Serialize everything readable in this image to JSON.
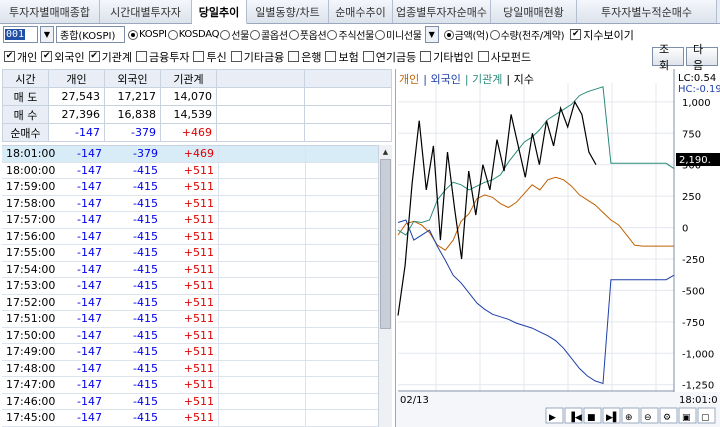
{
  "tabs": [
    "투자자별매매종합",
    "시간대별투자자",
    "당일추이",
    "일별동향/차트",
    "순매수추이",
    "업종별투자자순매수",
    "당일매매현황",
    "투자자별누적순매수"
  ],
  "active_tab": 2,
  "toolbar1": {
    "code": "001",
    "market_name": "종합(KOSPI)",
    "market_radios": [
      "KOSPI",
      "KOSDAQ",
      "선물",
      "콜옵션",
      "풋옵션",
      "주식선물",
      "미니선물"
    ],
    "unit_radios": [
      "금액(억)",
      "수량(천주/계약)"
    ],
    "index_view_label": "지수보이기"
  },
  "toolbar2": {
    "checkboxes": [
      {
        "label": "개인",
        "checked": true
      },
      {
        "label": "외국인",
        "checked": true
      },
      {
        "label": "기관계",
        "checked": true
      },
      {
        "label": "금융투자",
        "checked": false
      },
      {
        "label": "투신",
        "checked": false
      },
      {
        "label": "기타금융",
        "checked": false
      },
      {
        "label": "은행",
        "checked": false
      },
      {
        "label": "보험",
        "checked": false
      },
      {
        "label": "연기금등",
        "checked": false
      },
      {
        "label": "기타법인",
        "checked": false
      },
      {
        "label": "사모펀드",
        "checked": false
      }
    ],
    "query_button": "조회",
    "next_button": "다음"
  },
  "summary": {
    "headers": [
      "시간",
      "개인",
      "외국인",
      "기관계"
    ],
    "rows": [
      {
        "label": "매 도",
        "ind": "27,543",
        "for": "17,217",
        "ins": "14,070"
      },
      {
        "label": "매 수",
        "ind": "27,396",
        "for": "16,838",
        "ins": "14,539"
      },
      {
        "label": "순매수",
        "ind": "-147",
        "for": "-379",
        "ins": "+469"
      }
    ]
  },
  "timeline": [
    {
      "time": "18:01:00",
      "ind": "-147",
      "for": "-379",
      "ins": "+469"
    },
    {
      "time": "18:00:00",
      "ind": "-147",
      "for": "-415",
      "ins": "+511"
    },
    {
      "time": "17:59:00",
      "ind": "-147",
      "for": "-415",
      "ins": "+511"
    },
    {
      "time": "17:58:00",
      "ind": "-147",
      "for": "-415",
      "ins": "+511"
    },
    {
      "time": "17:57:00",
      "ind": "-147",
      "for": "-415",
      "ins": "+511"
    },
    {
      "time": "17:56:00",
      "ind": "-147",
      "for": "-415",
      "ins": "+511"
    },
    {
      "time": "17:55:00",
      "ind": "-147",
      "for": "-415",
      "ins": "+511"
    },
    {
      "time": "17:54:00",
      "ind": "-147",
      "for": "-415",
      "ins": "+511"
    },
    {
      "time": "17:53:00",
      "ind": "-147",
      "for": "-415",
      "ins": "+511"
    },
    {
      "time": "17:52:00",
      "ind": "-147",
      "for": "-415",
      "ins": "+511"
    },
    {
      "time": "17:51:00",
      "ind": "-147",
      "for": "-415",
      "ins": "+511"
    },
    {
      "time": "17:50:00",
      "ind": "-147",
      "for": "-415",
      "ins": "+511"
    },
    {
      "time": "17:49:00",
      "ind": "-147",
      "for": "-415",
      "ins": "+511"
    },
    {
      "time": "17:48:00",
      "ind": "-147",
      "for": "-415",
      "ins": "+511"
    },
    {
      "time": "17:47:00",
      "ind": "-147",
      "for": "-415",
      "ins": "+511"
    },
    {
      "time": "17:46:00",
      "ind": "-147",
      "for": "-415",
      "ins": "+511"
    },
    {
      "time": "17:45:00",
      "ind": "-147",
      "for": "-415",
      "ins": "+511"
    }
  ],
  "chart": {
    "legend": [
      {
        "label": "개인",
        "color": "#c06000"
      },
      {
        "label": "외국인",
        "color": "#1f3fa8"
      },
      {
        "label": "기관계",
        "color": "#2a8a7a"
      },
      {
        "label": "지수",
        "color": "#000000"
      }
    ],
    "lc_label": "LC:0.54",
    "hc_label": "HC:-0.19",
    "current_value": "2,190.",
    "date_label": "02/13",
    "time_label": "18:01:0",
    "ticks": [
      "1,000",
      "750",
      "500",
      "250",
      "0",
      "-250",
      "-500",
      "-750",
      "-1,000",
      "-1,250"
    ]
  },
  "chart_data": {
    "type": "line",
    "yaxis_ticks": [
      1000,
      750,
      500,
      250,
      0,
      -250,
      -500,
      -750,
      -1000,
      -1250
    ],
    "ylim": [
      -1300,
      1150
    ],
    "series": [
      {
        "name": "개인",
        "color": "#c06000",
        "values": [
          -60,
          30,
          50,
          20,
          -40,
          -140,
          -180,
          -100,
          50,
          110,
          230,
          260,
          240,
          190,
          160,
          200,
          270,
          340,
          300,
          380,
          400,
          380,
          330,
          260,
          220,
          180,
          120,
          60,
          20,
          -60,
          -140,
          -147,
          -147,
          -147,
          -147,
          -147
        ]
      },
      {
        "name": "외국인",
        "color": "#1f3fa8",
        "values": [
          40,
          60,
          -100,
          -60,
          -20,
          -150,
          -260,
          -380,
          -440,
          -520,
          -600,
          -650,
          -690,
          -710,
          -730,
          -760,
          -780,
          -800,
          -830,
          -860,
          -900,
          -960,
          -1040,
          -1120,
          -1180,
          -1220,
          -1240,
          -415,
          -415,
          -415,
          -415,
          -415,
          -415,
          -415,
          -415,
          -379
        ]
      },
      {
        "name": "기관계",
        "color": "#2a8a7a",
        "values": [
          -20,
          -60,
          50,
          40,
          60,
          220,
          300,
          360,
          340,
          300,
          330,
          360,
          380,
          420,
          520,
          600,
          680,
          720,
          780,
          860,
          900,
          940,
          980,
          1050,
          1080,
          1100,
          1120,
          511,
          511,
          511,
          511,
          511,
          511,
          511,
          511,
          469
        ]
      },
      {
        "name": "지수",
        "color": "#000000",
        "values": [
          -700,
          -300,
          350,
          850,
          300,
          650,
          -100,
          600,
          150,
          -250,
          450,
          100,
          500,
          300,
          700,
          450,
          900,
          650,
          400,
          750,
          500,
          850,
          650,
          950,
          800,
          1000,
          900,
          600,
          500
        ]
      }
    ]
  }
}
